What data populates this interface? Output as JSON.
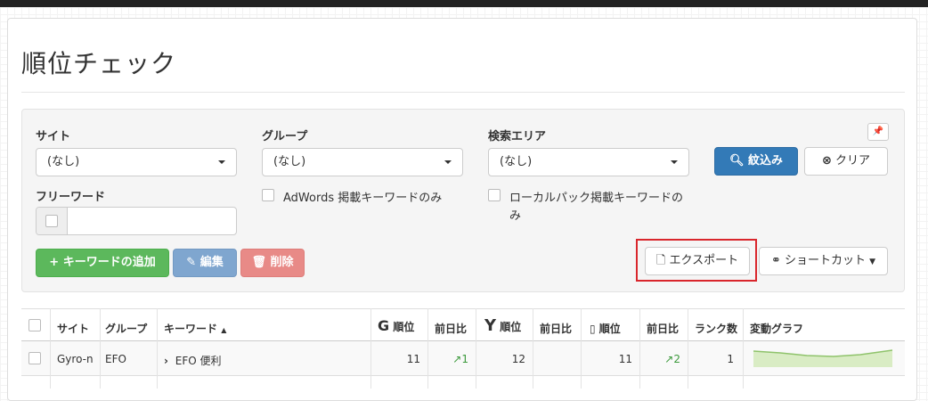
{
  "page": {
    "title": "順位チェック"
  },
  "filters": {
    "site": {
      "label": "サイト",
      "value": "(なし)"
    },
    "group": {
      "label": "グループ",
      "value": "(なし)"
    },
    "area": {
      "label": "検索エリア",
      "value": "(なし)"
    },
    "freeword": {
      "label": "フリーワード",
      "value": ""
    },
    "adwords_only": "AdWords 掲載キーワードのみ",
    "localpack_only_line1": "ローカルパック掲載キーワードの",
    "localpack_only_line2": "み",
    "search_button": "紋込み",
    "clear_button": "クリア"
  },
  "actions": {
    "add_keyword": "キーワードの追加",
    "edit": "編集",
    "delete": "削除",
    "export": "エクスポート",
    "shortcut": "ショートカット"
  },
  "table": {
    "headers": {
      "site": "サイト",
      "group": "グループ",
      "keyword": "キーワード",
      "google_rank": "順位",
      "google_diff": "前日比",
      "yahoo_rank": "順位",
      "yahoo_diff": "前日比",
      "mobile_rank": "順位",
      "mobile_diff": "前日比",
      "rank_count": "ランク数",
      "graph": "変動グラフ"
    },
    "rows": [
      {
        "site": "Gyro-n",
        "group": "EFO",
        "keyword": "EFO 便利",
        "google_rank": "11",
        "google_diff": "1",
        "yahoo_rank": "12",
        "yahoo_diff": "",
        "mobile_rank": "11",
        "mobile_diff": "2",
        "rank_count": "1"
      }
    ]
  },
  "colors": {
    "primary": "#337ab7",
    "success": "#5cb85c",
    "info": "#7fa6cf",
    "danger": "#e88a87",
    "highlight": "#d9262c",
    "sparkline": "#b5d98a"
  }
}
